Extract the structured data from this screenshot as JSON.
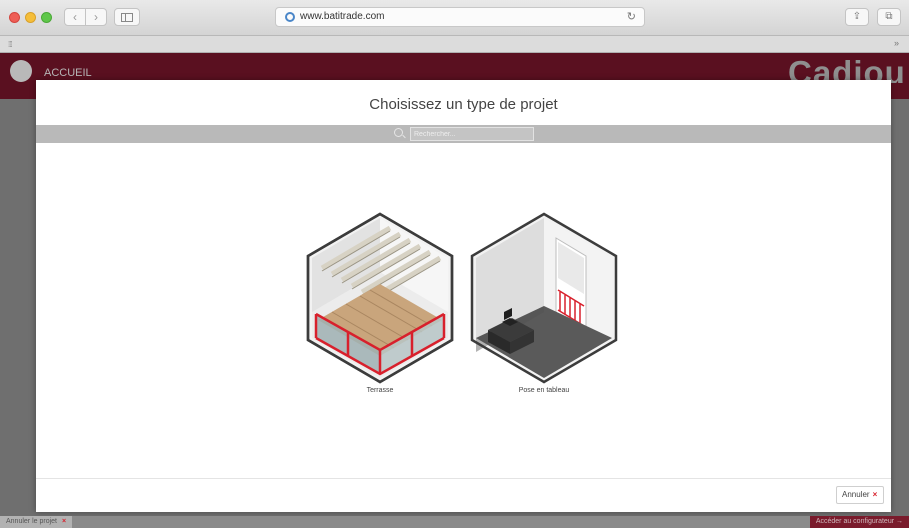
{
  "browser": {
    "url": "www.batitrade.com",
    "back_icon": "‹",
    "forward_icon": "›",
    "reload_icon": "↻",
    "share_icon": "⇪",
    "tabs_icon": "⧉",
    "more_icon": "»",
    "grid_icon": "⁞⁞⁞"
  },
  "site": {
    "nav_label": "ACCUEIL",
    "brand": "Cadiou"
  },
  "modal": {
    "title": "Choisissez un type de projet",
    "search_placeholder": "Rechercher...",
    "projects": [
      {
        "label": "Terrasse"
      },
      {
        "label": "Pose en tableau"
      }
    ],
    "cancel_label": "Annuler",
    "cancel_icon": "×"
  },
  "bottom": {
    "cancel_project_label": "Annuler le projet",
    "cancel_icon": "×",
    "configurator_label": "Accéder au configurateur",
    "configurator_icon": "→"
  },
  "colors": {
    "brand": "#5a1020",
    "accent_red": "#d8202c"
  }
}
